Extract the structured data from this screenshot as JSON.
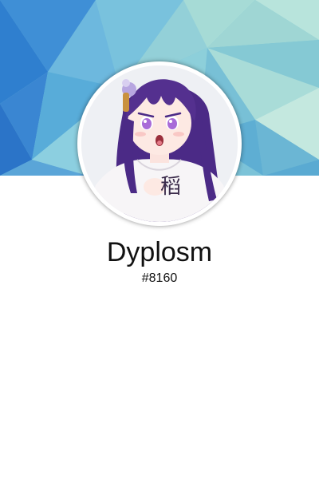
{
  "profile": {
    "username": "Dyplosm",
    "discriminator": "#8160",
    "avatar_shirt_text": "稻"
  },
  "theme": {
    "banner_colors": [
      "#2f7fd0",
      "#5fb7d6",
      "#8fd3d0",
      "#b9e3dc",
      "#3a8ed8"
    ],
    "avatar_border": "#ffffff",
    "hair_color": "#4b2a86",
    "eye_color": "#a86bd8",
    "background": "#ffffff"
  },
  "icons": {
    "avatar": "anime-girl-avatar-image",
    "banner": "low-poly-blue-banner-image"
  }
}
